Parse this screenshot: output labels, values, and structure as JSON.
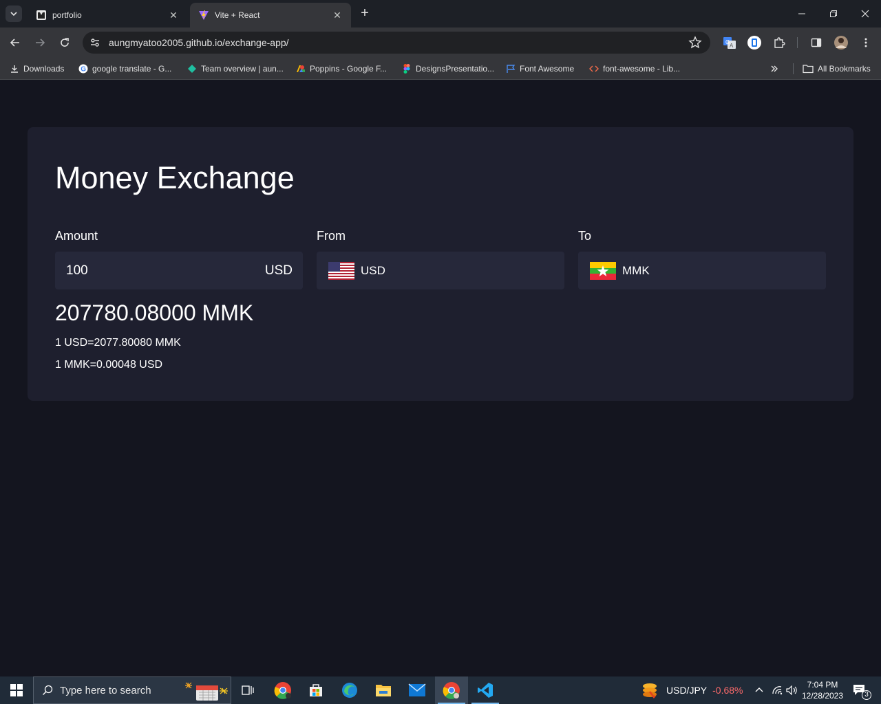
{
  "browser": {
    "tabs": [
      {
        "title": "portfolio",
        "active": false
      },
      {
        "title": "Vite + React",
        "active": true
      }
    ],
    "url": "aungmyatoo2005.github.io/exchange-app/",
    "bookmarks": [
      {
        "label": "Downloads",
        "icon": "download-icon"
      },
      {
        "label": "google translate - G...",
        "icon": "google-icon"
      },
      {
        "label": "Team overview | aun...",
        "icon": "diamond-icon"
      },
      {
        "label": "Poppins - Google F...",
        "icon": "google-fonts-icon"
      },
      {
        "label": "DesignsPresentatio...",
        "icon": "figma-icon"
      },
      {
        "label": "Font Awesome",
        "icon": "flag-icon"
      },
      {
        "label": "font-awesome - Lib...",
        "icon": "code-icon"
      }
    ],
    "all_bookmarks": "All Bookmarks"
  },
  "app": {
    "title": "Money Exchange",
    "amount_label": "Amount",
    "from_label": "From",
    "to_label": "To",
    "amount_value": "100",
    "amount_currency": "USD",
    "from_currency": "USD",
    "to_currency": "MMK",
    "result": "207780.08000 MMK",
    "rate_forward": "1 USD=2077.80080 MMK",
    "rate_reverse": "1 MMK=0.00048 USD"
  },
  "taskbar": {
    "search_placeholder": "Type here to search",
    "ticker_symbol": "USD/JPY",
    "ticker_change": "-0.68%",
    "ticker_change_color": "#ff6b6b",
    "time": "7:04 PM",
    "date": "12/28/2023",
    "notification_count": "3"
  }
}
